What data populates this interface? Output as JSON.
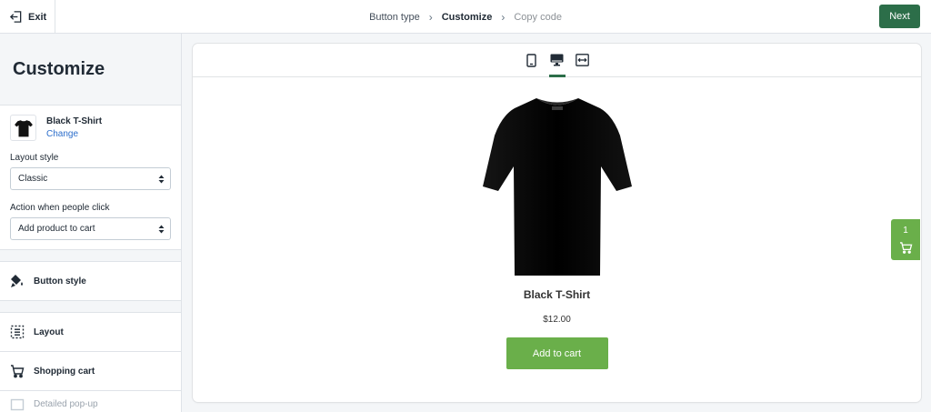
{
  "topbar": {
    "exit_label": "Exit",
    "steps": [
      "Button type",
      "Customize",
      "Copy code"
    ],
    "next_label": "Next"
  },
  "sidebar": {
    "title": "Customize",
    "product": {
      "name": "Black T-Shirt",
      "change_label": "Change"
    },
    "layout_style": {
      "label": "Layout style",
      "value": "Classic"
    },
    "click_action": {
      "label": "Action when people click",
      "value": "Add product to cart"
    },
    "items": [
      {
        "label": "Button style",
        "icon": "paint-bucket-icon"
      },
      {
        "label": "Layout",
        "icon": "layout-icon"
      },
      {
        "label": "Shopping cart",
        "icon": "cart-icon"
      },
      {
        "label": "Detailed pop-up",
        "icon": "popup-icon"
      }
    ]
  },
  "preview": {
    "devices": [
      "mobile-icon",
      "desktop-icon",
      "fullwidth-icon"
    ],
    "active_device": "desktop-icon",
    "product_title": "Black T-Shirt",
    "price": "$12.00",
    "button_label": "Add to cart"
  },
  "cart": {
    "count": "1"
  },
  "colors": {
    "next_button": "#2c6e49",
    "add_to_cart": "#6aaf4a",
    "link": "#2c6ecb"
  }
}
